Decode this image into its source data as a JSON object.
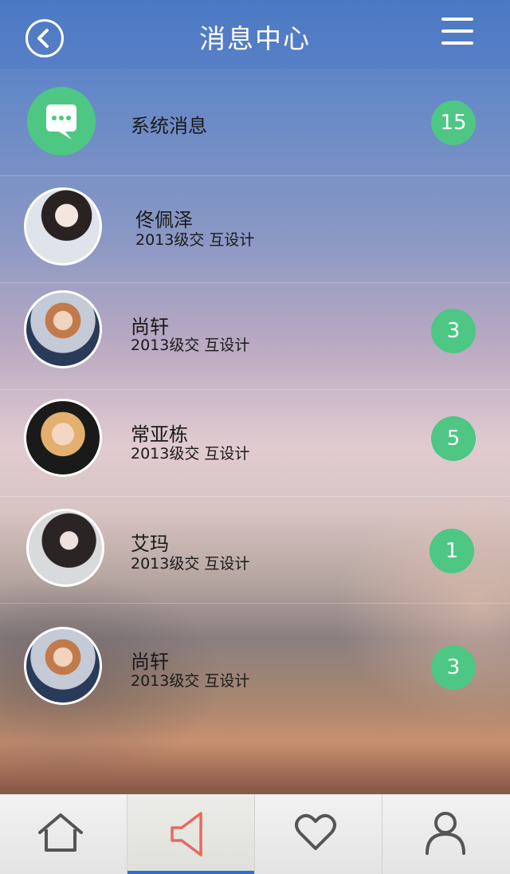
{
  "header": {
    "title": "消息中心",
    "back_icon": "back-arrow-icon",
    "menu_icon": "hamburger-menu-icon"
  },
  "messages": [
    {
      "type": "system",
      "name": "系统消息",
      "subtitle": "",
      "badge": "15",
      "icon": "chat-bubble-icon"
    },
    {
      "type": "contact",
      "name": "佟佩泽",
      "subtitle": "2013级交 互设计",
      "badge": ""
    },
    {
      "type": "contact",
      "name": "尚轩",
      "subtitle": "2013级交 互设计",
      "badge": "3"
    },
    {
      "type": "contact",
      "name": "常亚栋",
      "subtitle": "2013级交 互设计",
      "badge": "5"
    },
    {
      "type": "contact",
      "name": "艾玛",
      "subtitle": "2013级交 互设计",
      "badge": "1"
    },
    {
      "type": "contact",
      "name": "尚轩",
      "subtitle": "2013级交 互设计",
      "badge": "3"
    }
  ],
  "tabbar": {
    "tabs": [
      {
        "icon": "home-icon",
        "active": false
      },
      {
        "icon": "speaker-icon",
        "active": true
      },
      {
        "icon": "heart-icon",
        "active": false
      },
      {
        "icon": "user-icon",
        "active": false
      }
    ]
  },
  "colors": {
    "header": "#4c79c4",
    "badge": "#4dc783",
    "active_tab_icon": "#e8685c",
    "active_tab_indicator": "#2c6fd0"
  }
}
